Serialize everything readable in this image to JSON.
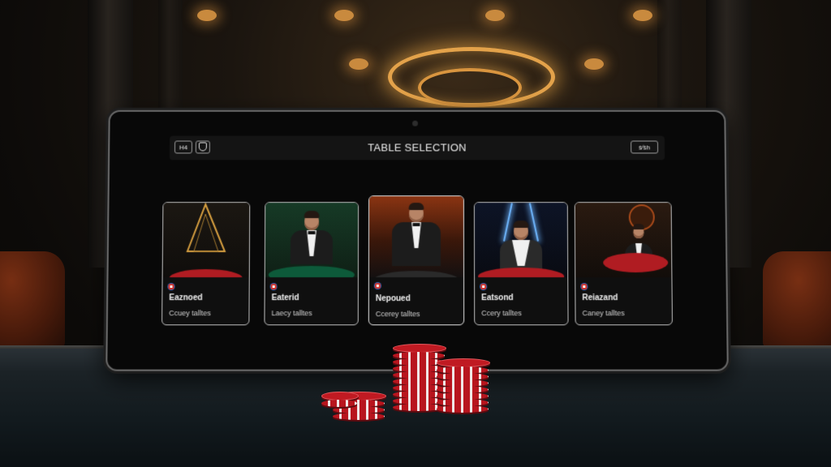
{
  "header": {
    "title": "TABLE SELECTION",
    "menu_label": "H4",
    "right_label": "ṡ∕ṡh"
  },
  "tables": [
    {
      "name": "Eaznoed",
      "subtitle": "Ccuey talltes",
      "felt_color": "#b01c22",
      "accent": "#d8a040"
    },
    {
      "name": "Eaterid",
      "subtitle": "Laecy talltes",
      "felt_color": "#0d5a3a",
      "accent": "#2a7a3e"
    },
    {
      "name": "Nepoued",
      "subtitle": "Ccerey talltes",
      "felt_color": "#2a2a2a",
      "accent": "#c24a1a",
      "selected": true
    },
    {
      "name": "Eatsond",
      "subtitle": "Ccery talltes",
      "felt_color": "#b01c22",
      "accent": "#3a7be0"
    },
    {
      "name": "Reiazand",
      "subtitle": "Caney talltes",
      "felt_color": "#b01c22",
      "accent": "#a84a1a"
    }
  ],
  "colors": {
    "screen": "#080808",
    "chip_red": "#b8151e",
    "ambient_gold": "#e3a24a"
  }
}
